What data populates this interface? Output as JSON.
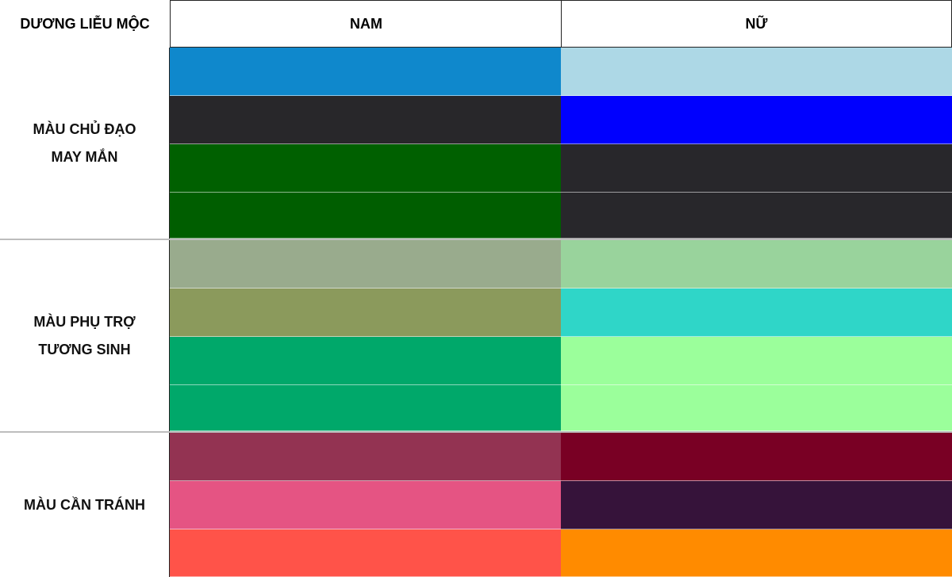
{
  "header": {
    "title": "DƯƠNG LIỄU MỘC",
    "col_nam": "NAM",
    "col_nu": "NỮ"
  },
  "sections": [
    {
      "label_lines": [
        "MÀU CHỦ ĐẠO",
        "MAY MẮN"
      ],
      "nam": [
        "#0f88cc",
        "#28272a",
        "#006000",
        "#005e00"
      ],
      "nu": [
        "#add8e6",
        "#0000fe",
        "#28272b",
        "#28272b"
      ]
    },
    {
      "label_lines": [
        "MÀU PHỤ TRỢ",
        "TƯƠNG SINH"
      ],
      "nam": [
        "#99ab8d",
        "#8b9a5c",
        "#00a86a",
        "#00a86a"
      ],
      "nu": [
        "#99d39c",
        "#2fd6c8",
        "#9bff9b",
        "#9bff9b"
      ]
    },
    {
      "label_lines": [
        "MÀU CẦN TRÁNH"
      ],
      "nam": [
        "#933352",
        "#e55483",
        "#ff5349"
      ],
      "nu": [
        "#790024",
        "#36133a",
        "#ff8b00"
      ]
    }
  ]
}
